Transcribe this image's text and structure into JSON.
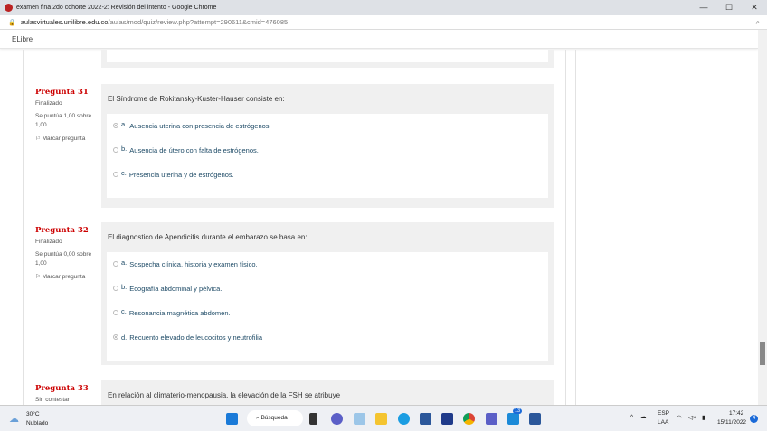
{
  "window": {
    "title": "examen fina 2do cohorte 2022-2: Revisión del intento - Google Chrome",
    "minimize": "—",
    "maximize": "☐",
    "close": "✕"
  },
  "address": {
    "domain": "aulasvirtuales.unilibre.edu.co",
    "path": "/aulas/mod/quiz/review.php?attempt=290611&cmid=476085"
  },
  "app": {
    "title": "ELibre"
  },
  "questions": [
    {
      "number": "Pregunta 31",
      "state": "Finalizado",
      "grade": "Se puntúa 1,00 sobre 1,00",
      "flag": "Marcar pregunta",
      "text": "El Síndrome de Rokitansky-Kuster-Hauser consiste en:",
      "options": [
        {
          "letter": "a.",
          "text": "Ausencia uterina con presencia de estrógenos",
          "selected": true
        },
        {
          "letter": "b.",
          "text": "Ausencia de útero con falta de estrógenos.",
          "selected": false
        },
        {
          "letter": "c.",
          "text": "Presencia uterina y de estrógenos.",
          "selected": false
        }
      ]
    },
    {
      "number": "Pregunta 32",
      "state": "Finalizado",
      "grade": "Se puntúa 0,00 sobre 1,00",
      "flag": "Marcar pregunta",
      "text": "El diagnostico de Apendicitis durante el embarazo se basa en:",
      "options": [
        {
          "letter": "a.",
          "text": "Sospecha clínica, historia y examen físico.",
          "selected": false
        },
        {
          "letter": "b.",
          "text": "Ecografía abdominal y pélvica.",
          "selected": false
        },
        {
          "letter": "c.",
          "text": "Resonancia magnética abdomen.",
          "selected": false
        },
        {
          "letter": "d.",
          "text": "Recuento elevado de leucocitos y neutrofilia",
          "selected": true
        }
      ]
    },
    {
      "number": "Pregunta 33",
      "state": "Sin contestar",
      "text": "En relación al climaterio-menopausia, la elevación de la FSH se atribuye"
    }
  ],
  "taskbar": {
    "weather_temp": "30°C",
    "weather_desc": "Nublado",
    "search": "Búsqueda",
    "mail_badge": "13",
    "lang1": "ESP",
    "lang2": "LAA",
    "time": "17:42",
    "date": "15/11/2022",
    "notif": "4"
  }
}
